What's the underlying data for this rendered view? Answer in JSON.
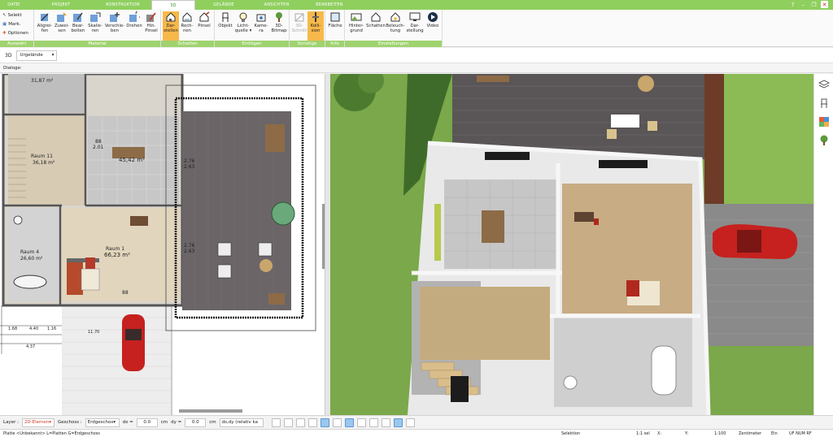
{
  "tabs": [
    {
      "label": "DATEI"
    },
    {
      "label": "PROJEKT"
    },
    {
      "label": "KONSTRUKTION"
    },
    {
      "label": "3D"
    },
    {
      "label": "GELÄNDE"
    },
    {
      "label": "ANSICHTEN"
    },
    {
      "label": "BEARBEITEN"
    }
  ],
  "ribbon": {
    "auswahl": {
      "title": "Auswahl",
      "items": [
        "Selekt",
        "Mark.",
        "Optionen"
      ]
    },
    "material": {
      "title": "Material",
      "buttons": [
        {
          "line1": "Aligrei-",
          "line2": "fen"
        },
        {
          "line1": "Zuwei-",
          "line2": "sen"
        },
        {
          "line1": "Bear-",
          "line2": "beiten"
        },
        {
          "line1": "Skalie-",
          "line2": "ren"
        },
        {
          "line1": "Verschie-",
          "line2": "ben"
        },
        {
          "line1": "Drehen",
          "line2": ""
        },
        {
          "line1": "Hin.",
          "line2": "Pinsel"
        }
      ]
    },
    "schatten": {
      "title": "Schatten",
      "buttons": [
        {
          "line1": "Dar-",
          "line2": "stellen"
        },
        {
          "line1": "Rech-",
          "line2": "nen"
        },
        {
          "line1": "Pinsel",
          "line2": ""
        }
      ]
    },
    "einfuegen": {
      "title": "Einfügen",
      "buttons": [
        {
          "line1": "Objekt",
          "line2": ""
        },
        {
          "line1": "Licht-",
          "line2": "quelle ▾"
        },
        {
          "line1": "Kame-",
          "line2": "ra"
        },
        {
          "line1": "3D-",
          "line2": "Bitmap"
        }
      ]
    },
    "sonstige": {
      "title": "Sonstige",
      "buttons": [
        {
          "line1": "3D-",
          "line2": "Schnitt"
        },
        {
          "line1": "Kolli-",
          "line2": "sion"
        }
      ]
    },
    "info": {
      "title": "Info",
      "buttons": [
        {
          "line1": "Fläche",
          "line2": ""
        }
      ]
    },
    "einstellungen": {
      "title": "Einstellungen",
      "buttons": [
        {
          "line1": "Hinter-",
          "line2": "grund"
        },
        {
          "line1": "Schatten",
          "line2": ""
        },
        {
          "line1": "Beleuch-",
          "line2": "tung"
        },
        {
          "line1": "Dar-",
          "line2": "stellung"
        },
        {
          "line1": "Video",
          "line2": ""
        }
      ]
    }
  },
  "viewbar": {
    "mode_label": "3D",
    "floor_select": "Urgelände"
  },
  "dialogbar": {
    "label": "Dialoge:"
  },
  "plan": {
    "rooms": [
      {
        "name": "",
        "area": "31,87 m²"
      },
      {
        "name": "Raum 11",
        "area": "36,18 m²"
      },
      {
        "name": "",
        "area": "45,42 m²"
      },
      {
        "name": "Raum 1",
        "area": "66,23 m²"
      },
      {
        "name": "Raum 4",
        "area": "26,60 m²"
      }
    ],
    "door_labels": [
      "88",
      "2.01",
      "88",
      "2.01",
      "2.76",
      "2.63",
      "2.76",
      "2.63",
      "88",
      "2.01",
      "88",
      "2.01",
      "88"
    ],
    "dimensions": [
      "1.68",
      "4.40",
      "1.16",
      "4.37",
      "11.70"
    ]
  },
  "bottombar": {
    "layer_label": "Layer :",
    "layer_value": "2D-Elemen",
    "geschoss_label": "Geschoss :",
    "geschoss_value": "Erdgeschos",
    "dx_label": "dx =",
    "dx_value": "0.0",
    "dx_unit": "cm",
    "dy_label": "dy =",
    "dy_value": "0.0",
    "dy_unit": "cm",
    "mode_value": "ds,dy (relativ ka"
  },
  "statusbar": {
    "left": "Platte <Unbekannt> L=Platten G=Erdgeschoss",
    "selection": "Selektion",
    "scale1": "1:1 sel",
    "x": "X:",
    "y": "Y:",
    "scale2": "1:100",
    "unit": "Zentimeter",
    "ein": "Ein",
    "flags": "UF NUM RF"
  },
  "colors": {
    "tab_green": "#8fcf5e",
    "group_title_green": "#9fd36e",
    "selected_orange": "#f7b84a",
    "grass": "#7aa84a",
    "deck": "#5a5556",
    "car_red": "#c6211e"
  },
  "sidepanel_icons": [
    "layers-icon",
    "chair-icon",
    "palette-icon",
    "tree-icon"
  ]
}
